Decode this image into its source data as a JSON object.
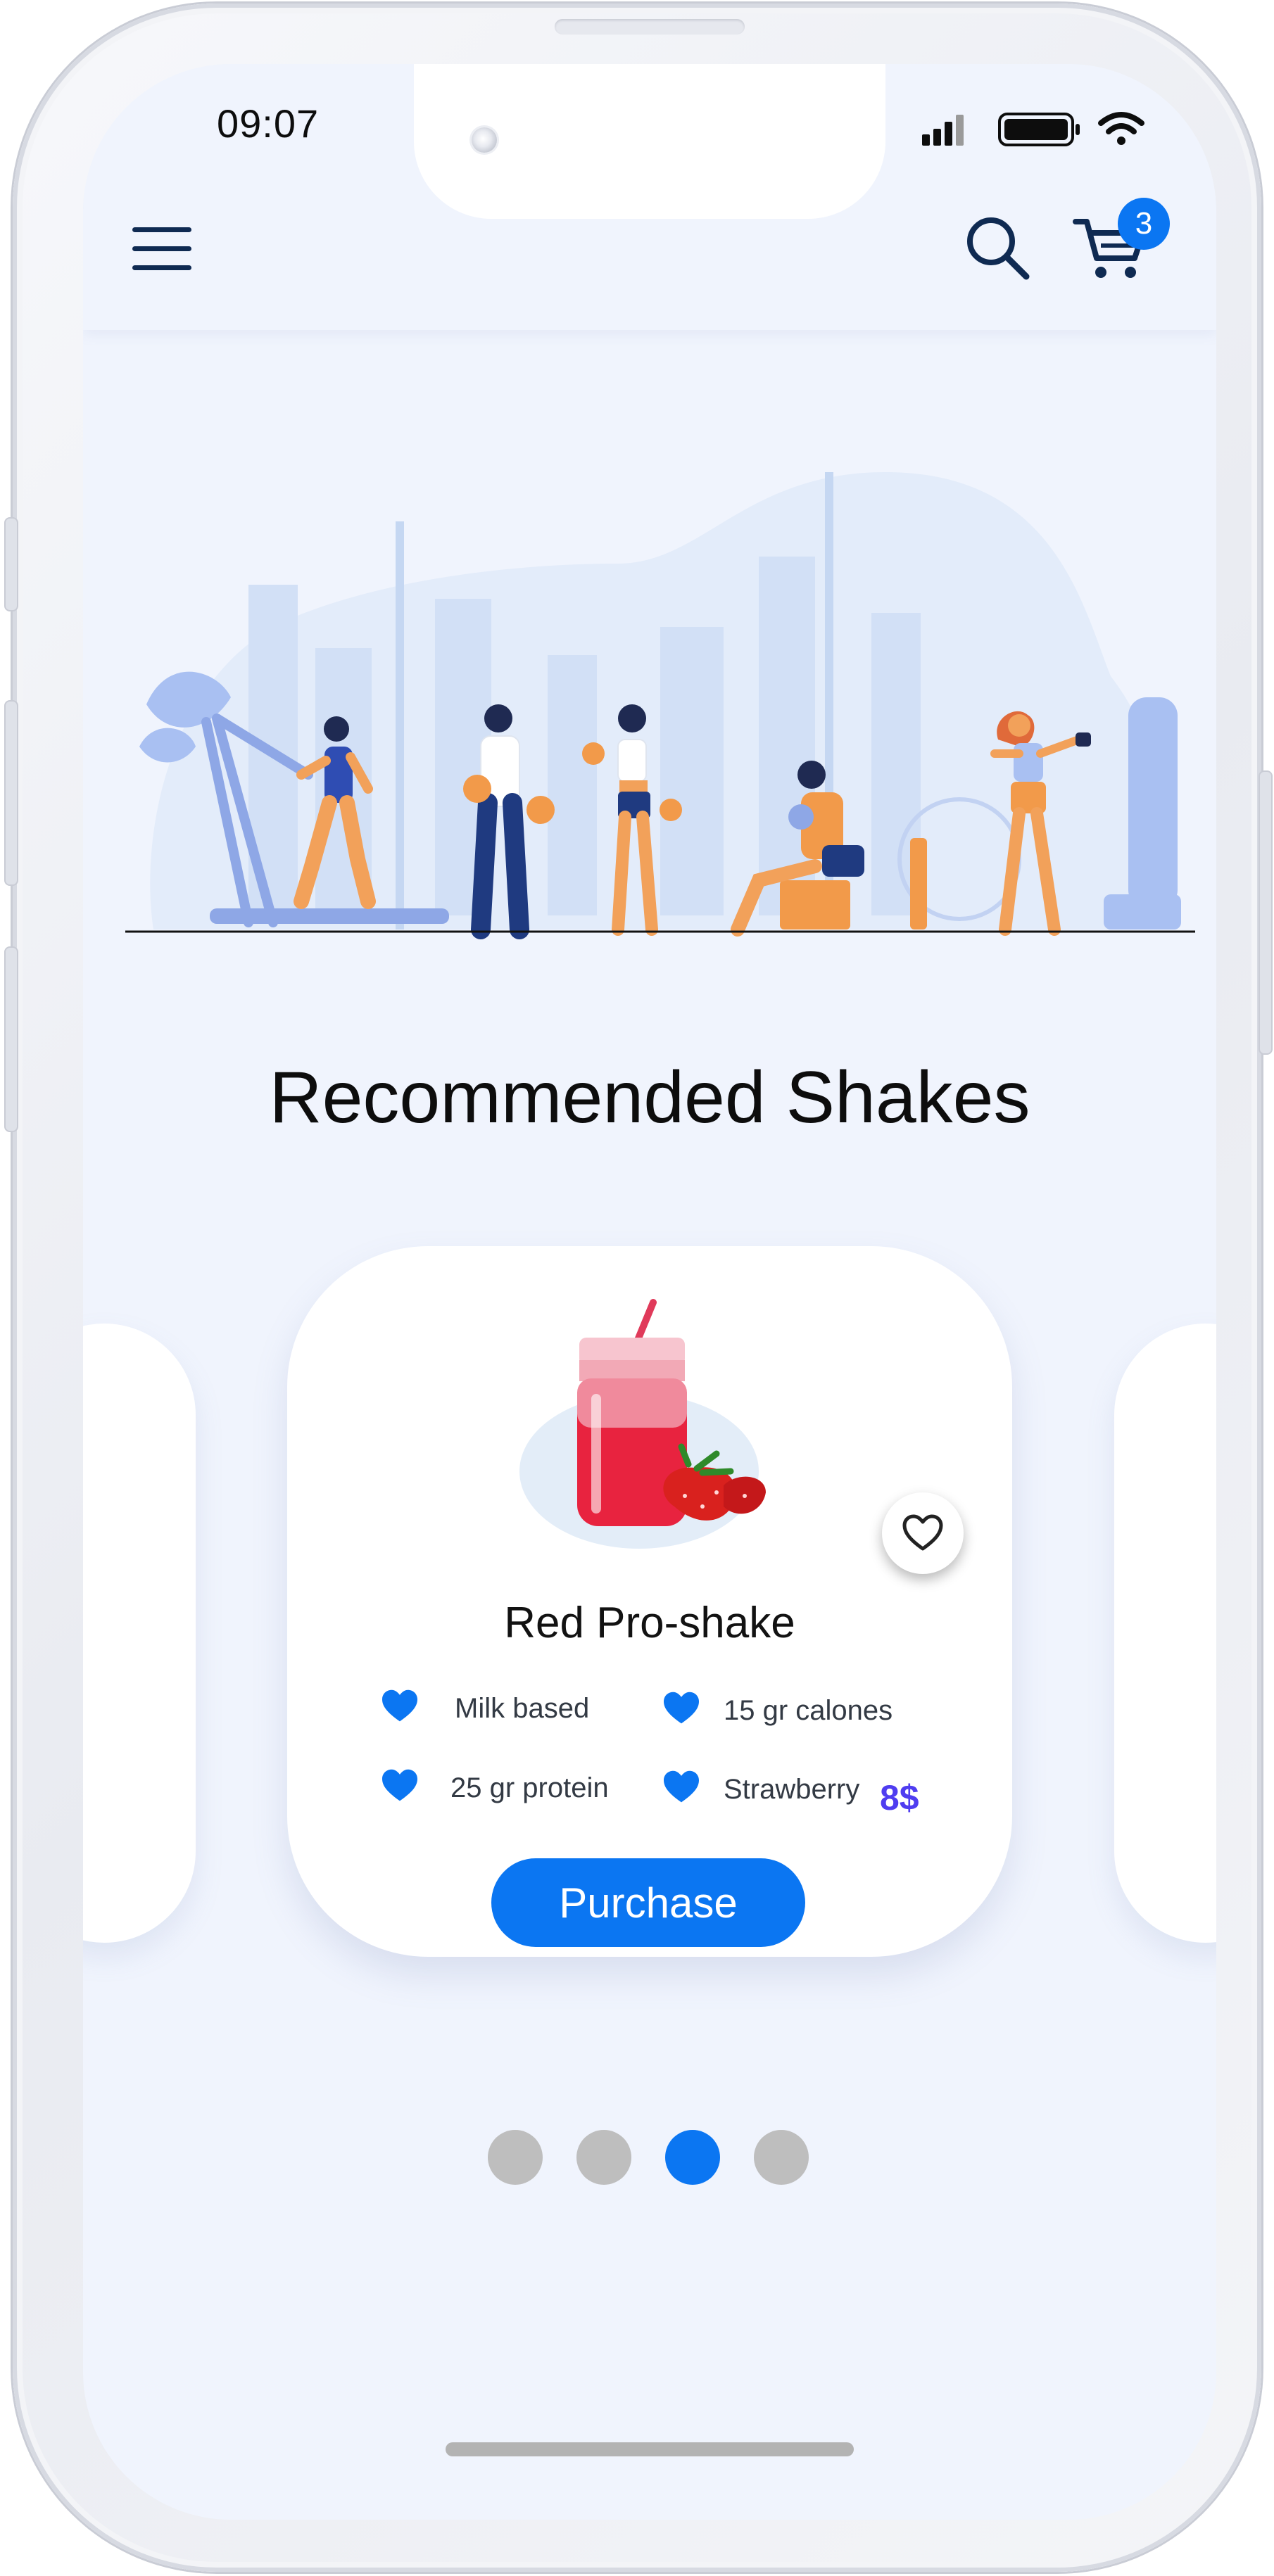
{
  "status_bar": {
    "time": "09:07"
  },
  "header": {
    "menu_icon": "hamburger-menu-icon",
    "search_icon": "search-icon",
    "cart_icon": "shopping-cart-icon",
    "cart_count": "3"
  },
  "section": {
    "title": "Recommended Shakes"
  },
  "product": {
    "name": "Red Pro-shake",
    "illustration": "strawberry-shake-jar",
    "features": [
      "Milk based",
      "15 gr calones",
      "25 gr protein",
      "Strawberry"
    ],
    "price": "8$",
    "purchase_label": "Purchase",
    "favorite_icon": "heart-outline-icon"
  },
  "pagination": {
    "total": 4,
    "active_index": 2
  },
  "colors": {
    "accent": "#0b76f2",
    "price": "#4f3df0",
    "background": "#f0f4fd",
    "navy": "#0f2a52",
    "dot_inactive": "#bebebe"
  }
}
